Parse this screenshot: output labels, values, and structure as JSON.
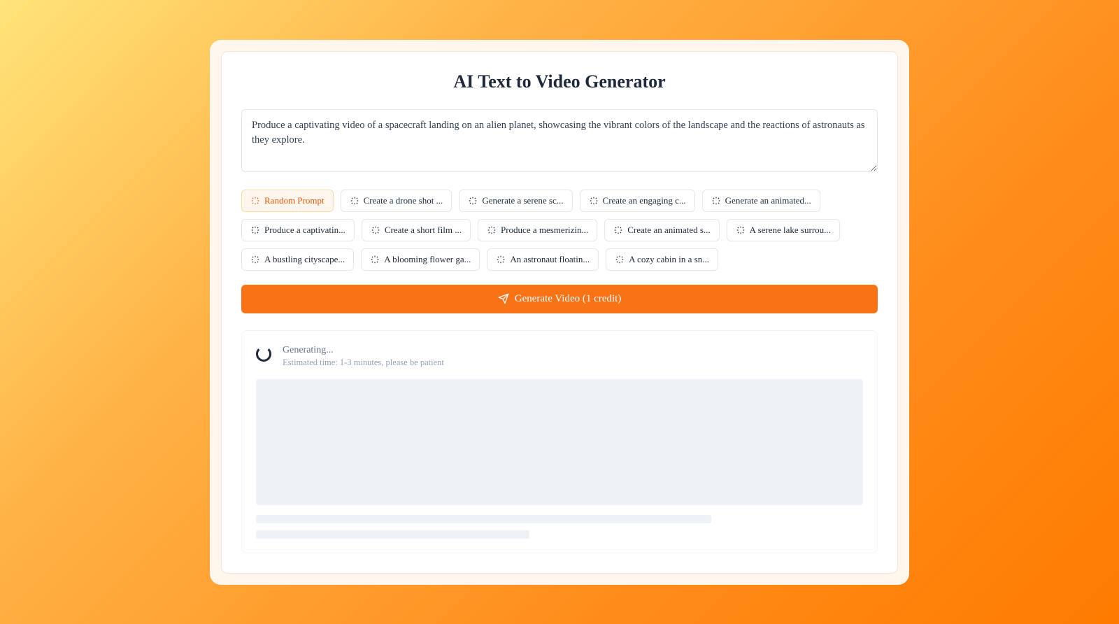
{
  "header": {
    "title": "AI Text to Video Generator"
  },
  "prompt": {
    "value": "Produce a captivating video of a spacecraft landing on an alien planet, showcasing the vibrant colors of the landscape and the reactions of astronauts as they explore."
  },
  "chips": {
    "random_label": "Random Prompt",
    "suggestions": [
      "Create a drone shot ...",
      "Generate a serene sc...",
      "Create an engaging c...",
      "Generate an animated...",
      "Produce a captivatin...",
      "Create a short film ...",
      "Produce a mesmerizin...",
      "Create an animated s...",
      "A serene lake surrou...",
      "A bustling cityscape...",
      "A blooming flower ga...",
      "An astronaut floatin...",
      "A cozy cabin in a sn..."
    ]
  },
  "actions": {
    "generate_label": "Generate Video (1 credit)"
  },
  "status": {
    "title": "Generating...",
    "subtitle": "Estimated time: 1-3 minutes, please be patient"
  }
}
